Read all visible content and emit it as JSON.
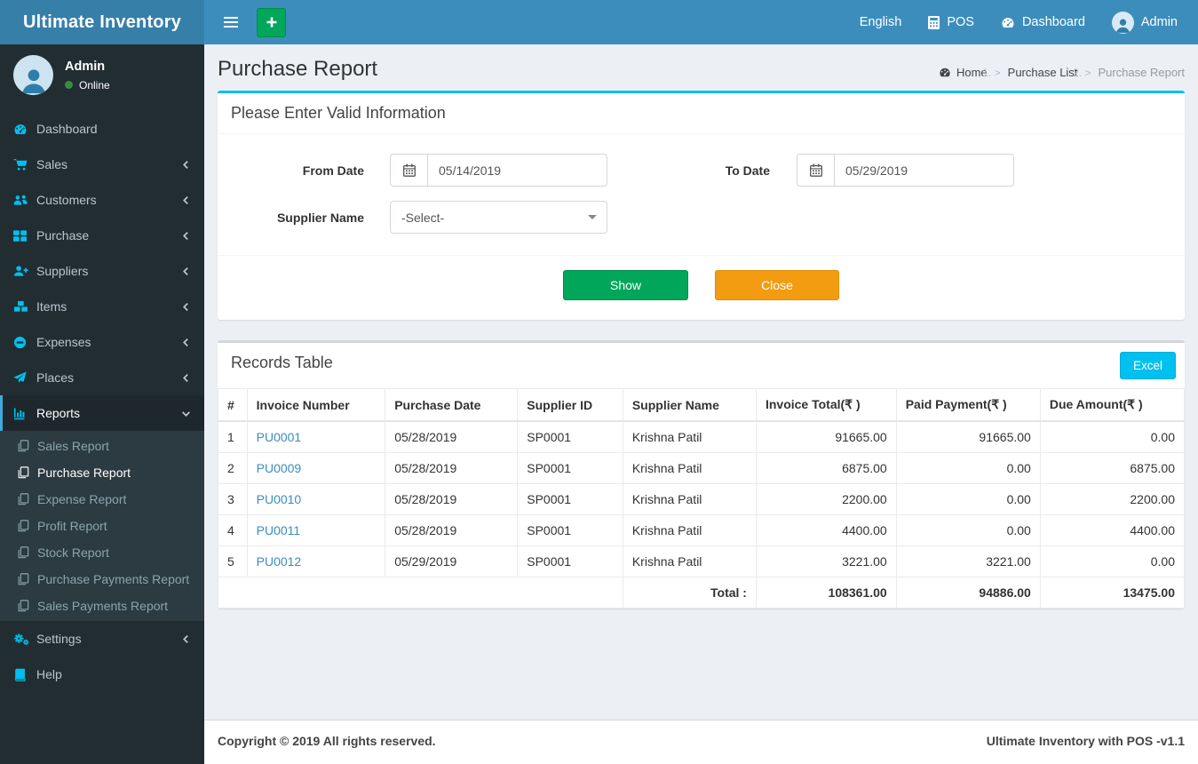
{
  "brand": "Ultimate Inventory",
  "navbar": {
    "language": "English",
    "pos": "POS",
    "dashboard": "Dashboard",
    "user": "Admin"
  },
  "sidebar": {
    "user": {
      "name": "Admin",
      "status": "Online"
    },
    "items": [
      {
        "label": "Dashboard",
        "icon": "tachometer-icon"
      },
      {
        "label": "Sales",
        "icon": "cart-icon"
      },
      {
        "label": "Customers",
        "icon": "users-icon"
      },
      {
        "label": "Purchase",
        "icon": "grid-icon"
      },
      {
        "label": "Suppliers",
        "icon": "user-plus-icon"
      },
      {
        "label": "Items",
        "icon": "cubes-icon"
      },
      {
        "label": "Expenses",
        "icon": "minus-circle-icon"
      },
      {
        "label": "Places",
        "icon": "paper-plane-icon"
      },
      {
        "label": "Reports",
        "icon": "bar-chart-icon",
        "expanded": true
      },
      {
        "label": "Settings",
        "icon": "gears-icon"
      },
      {
        "label": "Help",
        "icon": "book-icon"
      }
    ],
    "report_items": [
      {
        "label": "Sales Report"
      },
      {
        "label": "Purchase Report",
        "active": true
      },
      {
        "label": "Expense Report"
      },
      {
        "label": "Profit Report"
      },
      {
        "label": "Stock Report"
      },
      {
        "label": "Purchase Payments Report"
      },
      {
        "label": "Sales Payments Report"
      }
    ]
  },
  "page": {
    "title": "Purchase Report",
    "breadcrumb": [
      {
        "label": "Home"
      },
      {
        "label": "Purchase List"
      },
      {
        "label": "Purchase Report"
      }
    ]
  },
  "filter_card": {
    "title": "Please Enter Valid Information",
    "from_date": {
      "label": "From Date",
      "value": "05/14/2019"
    },
    "to_date": {
      "label": "To Date",
      "value": "05/29/2019"
    },
    "supplier": {
      "label": "Supplier Name",
      "value": "-Select-"
    },
    "show_button": "Show",
    "close_button": "Close"
  },
  "records_card": {
    "title": "Records Table",
    "excel_button": "Excel",
    "table": {
      "headers": [
        "#",
        "Invoice Number",
        "Purchase Date",
        "Supplier ID",
        "Supplier Name",
        "Invoice Total(₹ )",
        "Paid Payment(₹ )",
        "Due Amount(₹ )"
      ],
      "rows": [
        [
          "1",
          "PU0001",
          "05/28/2019",
          "SP0001",
          "Krishna Patil",
          "91665.00",
          "91665.00",
          "0.00"
        ],
        [
          "2",
          "PU0009",
          "05/28/2019",
          "SP0001",
          "Krishna Patil",
          "6875.00",
          "0.00",
          "6875.00"
        ],
        [
          "3",
          "PU0010",
          "05/28/2019",
          "SP0001",
          "Krishna Patil",
          "2200.00",
          "0.00",
          "2200.00"
        ],
        [
          "4",
          "PU0011",
          "05/28/2019",
          "SP0001",
          "Krishna Patil",
          "4400.00",
          "0.00",
          "4400.00"
        ],
        [
          "5",
          "PU0012",
          "05/29/2019",
          "SP0001",
          "Krishna Patil",
          "3221.00",
          "3221.00",
          "0.00"
        ]
      ],
      "total": {
        "label": "Total :",
        "invoice_total": "108361.00",
        "paid_payment": "94886.00",
        "due_amount": "13475.00"
      }
    }
  },
  "footer": {
    "left": "Copyright © 2019 All rights reserved.",
    "right": "Ultimate Inventory with POS -v1.1"
  },
  "colors": {
    "navbar": "#3c8dbc",
    "logo_bg": "#367fa9",
    "sidebar_bg": "#222d32",
    "submenu_bg": "#2c3b41",
    "content_bg": "#ecf0f5",
    "accent_cyan": "#00c0ef",
    "green": "#00a65a",
    "orange": "#f39c12",
    "link_blue": "#3c8dbc",
    "sidebar_icon": "#00c0ef"
  }
}
